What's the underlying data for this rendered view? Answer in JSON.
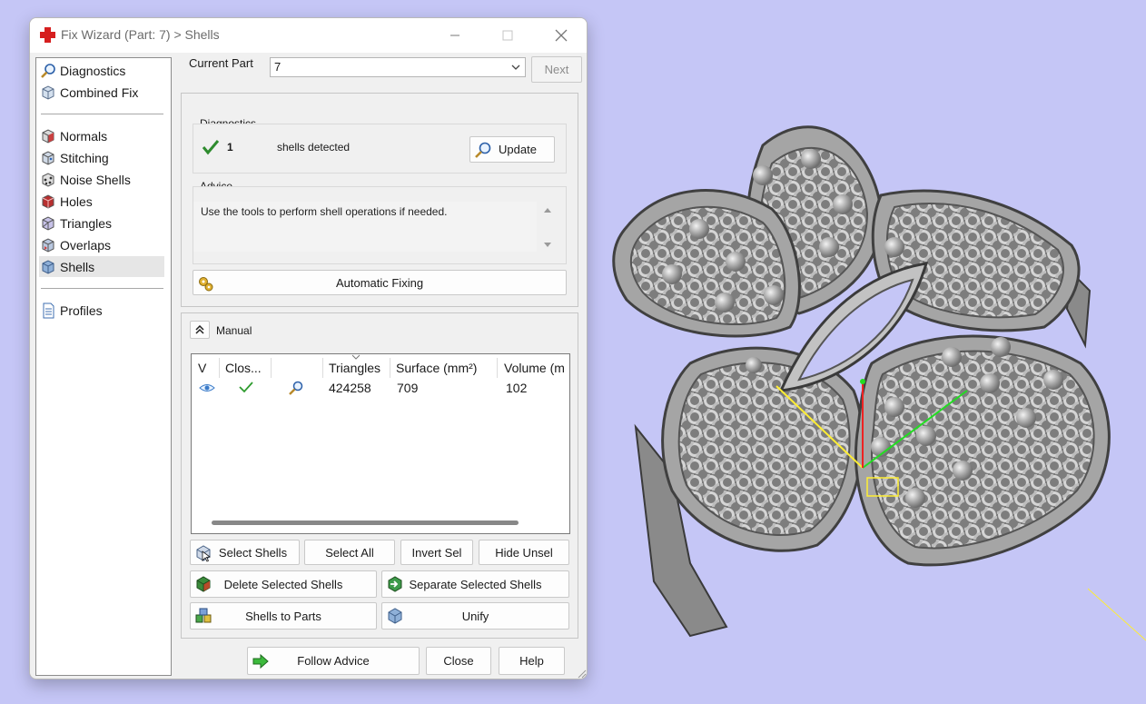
{
  "window": {
    "title": "Fix Wizard (Part: 7) > Shells"
  },
  "nav": {
    "top_items": [
      {
        "label": "Diagnostics",
        "icon": "magnifier-icon"
      },
      {
        "label": "Combined Fix",
        "icon": "cube-icon"
      }
    ],
    "tool_items": [
      {
        "label": "Normals",
        "icon": "normals-cube-icon"
      },
      {
        "label": "Stitching",
        "icon": "stitching-cube-icon"
      },
      {
        "label": "Noise Shells",
        "icon": "noise-shells-icon"
      },
      {
        "label": "Holes",
        "icon": "holes-cube-icon"
      },
      {
        "label": "Triangles",
        "icon": "triangles-cube-icon"
      },
      {
        "label": "Overlaps",
        "icon": "overlaps-cube-icon"
      },
      {
        "label": "Shells",
        "icon": "shells-cube-icon",
        "selected": true
      }
    ],
    "bottom_items": [
      {
        "label": "Profiles",
        "icon": "document-icon"
      }
    ]
  },
  "current_part": {
    "label": "Current Part",
    "value": "7",
    "next_label": "Next"
  },
  "diagnostics": {
    "group_label": "Diagnostics",
    "count": "1",
    "status_text": "shells detected",
    "update_label": "Update"
  },
  "advice": {
    "group_label": "Advice",
    "text": "Use the tools to perform shell operations if needed."
  },
  "automatic_fixing_label": "Automatic Fixing",
  "manual": {
    "label": "Manual",
    "columns": [
      "V",
      "Clos...",
      "",
      "Triangles",
      "Surface (mm²)",
      "Volume (m"
    ],
    "rows": [
      {
        "triangles": "424258",
        "surface": "709",
        "volume": "102"
      }
    ],
    "buttons": {
      "select_shells": "Select Shells",
      "select_all": "Select All",
      "invert_sel": "Invert Sel",
      "hide_unsel": "Hide Unsel",
      "delete_selected": "Delete Selected Shells",
      "separate_selected": "Separate Selected Shells",
      "shells_to_parts": "Shells to Parts",
      "unify": "Unify"
    }
  },
  "footer": {
    "follow_advice": "Follow Advice",
    "close": "Close",
    "help": "Help"
  },
  "viewport": {
    "background": "#c5c6f6",
    "model_color": "#9a9a9a",
    "axis_x_color": "#ffee33",
    "axis_y_color": "#22dd22",
    "axis_z_color": "#ee2222"
  }
}
